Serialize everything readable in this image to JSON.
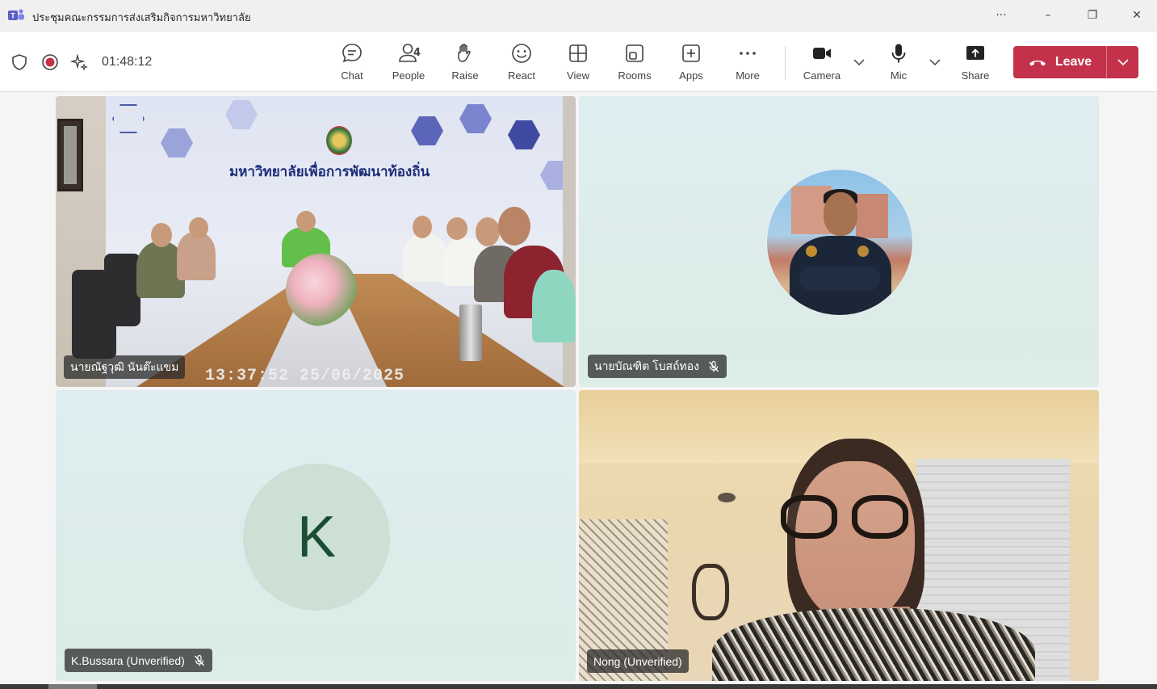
{
  "window": {
    "title": "ประชุมคณะกรรมการส่งเสริมกิจการมหาวิทยาลัย",
    "more_label": "···",
    "minimize_label": "–",
    "maximize_label": "❐",
    "close_label": "✕"
  },
  "meeting": {
    "timer": "01:48:12"
  },
  "toolbar": {
    "chat": "Chat",
    "people": "People",
    "people_count": "4",
    "raise": "Raise",
    "react": "React",
    "view": "View",
    "rooms": "Rooms",
    "apps": "Apps",
    "more": "More",
    "camera": "Camera",
    "mic": "Mic",
    "share": "Share",
    "leave": "Leave"
  },
  "tiles": [
    {
      "name": "นายณัฐวุฒิ นันต๊ะแขม",
      "muted": false,
      "room_sign": "มหาวิทยาลัยเพื่อการพัฒนาท้องถิ่น",
      "timestamp": "13:37:52 25/06/2025"
    },
    {
      "name": "นายบัณฑิต โบสถ์ทอง",
      "muted": true
    },
    {
      "name": "K.Bussara (Unverified)",
      "muted": true,
      "initial": "K"
    },
    {
      "name": "Nong (Unverified)",
      "muted": false
    }
  ],
  "colors": {
    "leave_red": "#c4314b",
    "teams_purple": "#5b5fc7",
    "record_red": "#c4314b",
    "initial_text": "#1a4d32",
    "initial_bg": "#cde0d6"
  }
}
